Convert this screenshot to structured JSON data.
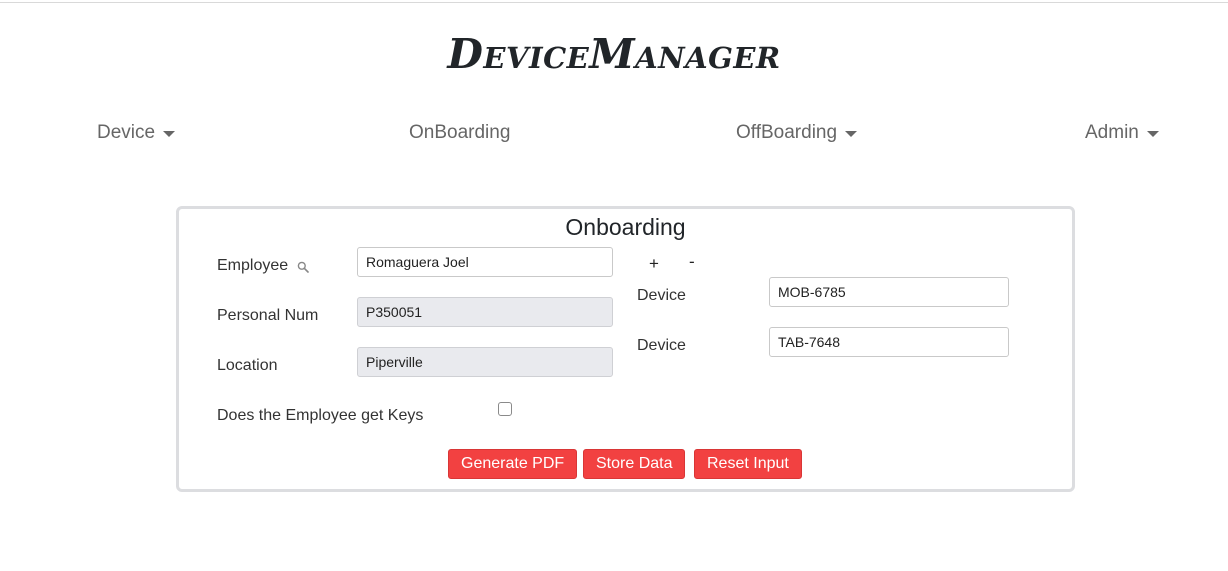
{
  "app": {
    "title": "DeviceManager"
  },
  "nav": {
    "items": [
      {
        "label": "Device",
        "dropdown": true
      },
      {
        "label": "OnBoarding",
        "dropdown": false
      },
      {
        "label": "OffBoarding",
        "dropdown": true
      },
      {
        "label": "Admin",
        "dropdown": true
      }
    ]
  },
  "form": {
    "title": "Onboarding",
    "employee": {
      "label": "Employee",
      "value": "Romaguera Joel",
      "icon": "search-icon"
    },
    "personal_num": {
      "label": "Personal Num",
      "value": "P350051"
    },
    "location": {
      "label": "Location",
      "value": "Piperville"
    },
    "keys": {
      "label": "Does the Employee get Keys",
      "checked": false
    },
    "device_controls": {
      "add": "+",
      "remove": "-"
    },
    "devices": [
      {
        "label": "Device",
        "value": "MOB-6785"
      },
      {
        "label": "Device",
        "value": "TAB-7648"
      }
    ],
    "buttons": {
      "generate_pdf": "Generate PDF",
      "store_data": "Store Data",
      "reset_input": "Reset Input"
    }
  },
  "colors": {
    "button_red": "#f24141",
    "readonly_bg": "#e9eaee",
    "nav_text": "#666666"
  }
}
